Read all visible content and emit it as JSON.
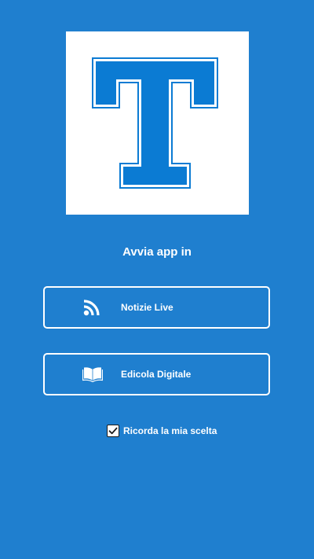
{
  "logo": {
    "letter": "T",
    "icon": "letter-t-logo",
    "background_color": "#ffffff",
    "letter_color": "#0b7bd3"
  },
  "heading": "Avvia app in",
  "options": [
    {
      "label": "Notizie Live",
      "icon": "rss-icon"
    },
    {
      "label": "Edicola Digitale",
      "icon": "open-book-icon"
    }
  ],
  "remember": {
    "label": "Ricorda la mia scelta",
    "checked": true
  },
  "colors": {
    "background": "#1f7fcf",
    "text": "#ffffff",
    "border": "#ffffff"
  }
}
